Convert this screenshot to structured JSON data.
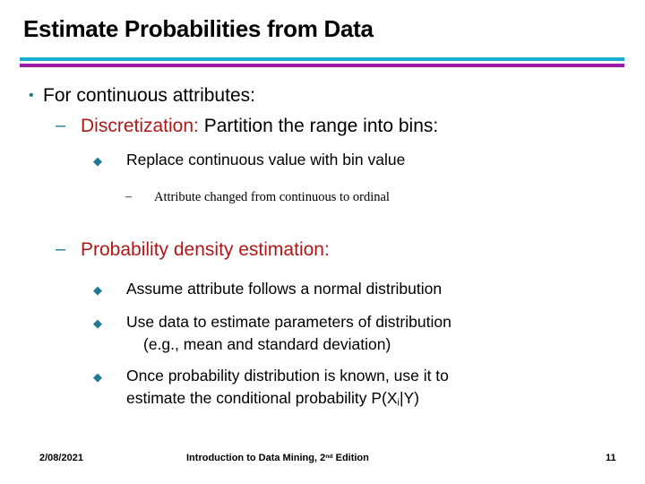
{
  "slide": {
    "title": "Estimate Probabilities from Data",
    "accent_cyan": "#19b0cf",
    "accent_magenta": "#9c1ba8",
    "accent_teal": "#1f7a91",
    "accent_red": "#b01818"
  },
  "bullets": {
    "l1_text": "For continuous attributes:",
    "l1_glyph": "•",
    "l2a_glyph": "–",
    "l2a_red": "Discretization:",
    "l2a_black": " Partition the range into bins:",
    "l3a_glyph": "◆",
    "l3a_text": "Replace continuous value with bin value",
    "l4a_glyph": "–",
    "l4a_text": "Attribute changed from continuous to ordinal",
    "l2b_glyph": "–",
    "l2b_text": "Probability density estimation:",
    "l3b_glyph": "◆",
    "l3b_text": "Assume attribute follows a normal distribution",
    "l3c_glyph": "◆",
    "l3c_line1": "Use data to estimate parameters of distribution",
    "l3c_line2": "(e.g., mean and standard deviation)",
    "l3d_glyph": "◆",
    "l3d_line1": "Once probability distribution is known, use it to",
    "l3d_line2_pre": "estimate the conditional probability P(X",
    "l3d_line2_sub": "i",
    "l3d_line2_post": "|Y)"
  },
  "footer": {
    "date": "2/08/2021",
    "center_pre": "Introduction to Data Mining, 2",
    "center_sup": "nd",
    "center_post": " Edition",
    "page": "11"
  }
}
